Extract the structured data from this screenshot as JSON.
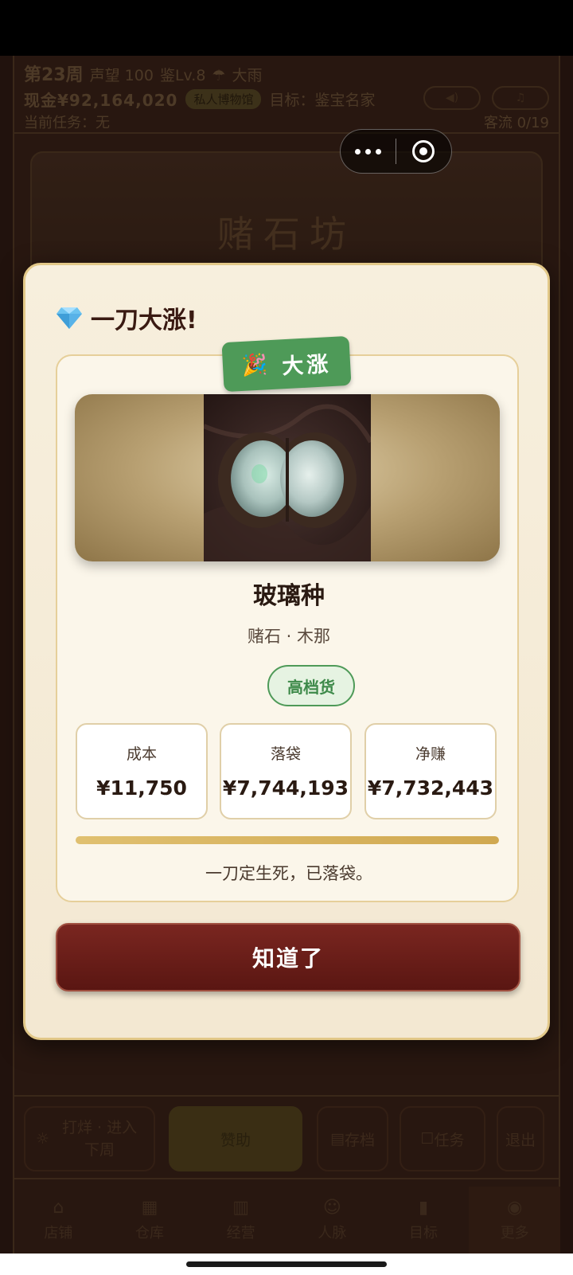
{
  "hud": {
    "week": "第23周",
    "reputation": "声望 100",
    "appraisal_level": "鉴Lv.8",
    "weather": "大雨",
    "cash": "现金¥92,164,020",
    "badge": "私人博物馆",
    "goal": "目标：鉴宝名家",
    "task": "当前任务：无",
    "customer_flow": "客流 0/19"
  },
  "shop": {
    "title": "赌石坊"
  },
  "action_bar": {
    "forge_label": "打烊 · 进入下周",
    "sponsor_label": "赞助",
    "save_label": "存档",
    "task_label": "任务",
    "exit_label": "退出"
  },
  "tabs": [
    {
      "label": "店铺",
      "icon": "shop-icon"
    },
    {
      "label": "仓库",
      "icon": "warehouse-icon"
    },
    {
      "label": "经营",
      "icon": "business-icon"
    },
    {
      "label": "人脉",
      "icon": "people-icon"
    },
    {
      "label": "目标",
      "icon": "goal-icon"
    },
    {
      "label": "更多",
      "icon": "more-icon"
    }
  ],
  "modal": {
    "title": "一刀大涨!",
    "ribbon": "大涨",
    "stone_name": "玻璃种",
    "stone_sub": "赌石 · 木那",
    "grade": "高档货",
    "stats": [
      {
        "label": "成本",
        "value": "¥11,750"
      },
      {
        "label": "落袋",
        "value": "¥7,744,193"
      },
      {
        "label": "净赚",
        "value": "¥7,732,443"
      }
    ],
    "progress": 1.0,
    "verdict": "一刀定生死，已落袋。",
    "confirm": "知道了"
  },
  "colors": {
    "accent_green": "#4e9a58",
    "button_red": "#6a1e18",
    "gold": "#d8b460"
  }
}
